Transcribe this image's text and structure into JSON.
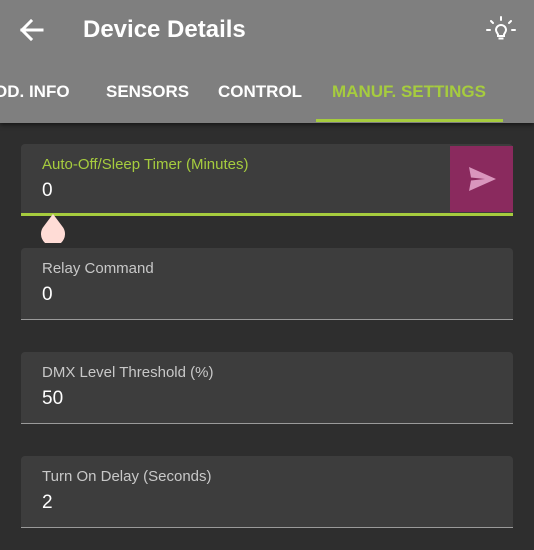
{
  "header": {
    "title": "Device Details",
    "back_icon": "arrow-left-icon",
    "action_icon": "lightbulb-icon"
  },
  "tabs": [
    {
      "label": "OD. INFO",
      "active": false
    },
    {
      "label": "SENSORS",
      "active": false
    },
    {
      "label": "CONTROL",
      "active": false
    },
    {
      "label": "MANUF. SETTINGS",
      "active": true
    }
  ],
  "fields": [
    {
      "label": "Auto-Off/Sleep Timer (Minutes)",
      "value": "0",
      "focused": true
    },
    {
      "label": "Relay Command",
      "value": "0",
      "focused": false
    },
    {
      "label": "DMX Level Threshold (%)",
      "value": "50",
      "focused": false
    },
    {
      "label": "Turn On Delay (Seconds)",
      "value": "2",
      "focused": false
    }
  ],
  "send_icon": "send-icon",
  "colors": {
    "header_bg": "#7f7f7f",
    "accent": "#a6cc3e",
    "send_button": "#8a2a5e",
    "background": "#2e2e2e",
    "field_bg": "#3d3d3d",
    "text_cursor_handle": "#ffdcd6"
  }
}
